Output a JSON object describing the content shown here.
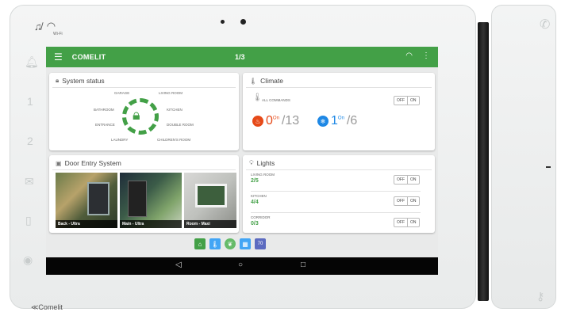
{
  "device": {
    "brand_logo": "≪Comelit",
    "wifi_label": "Wi-Fi",
    "colors": {
      "accent": "#43a047",
      "bezel": "#eeefef",
      "navbar": "#050505"
    }
  },
  "appbar": {
    "title": "COMELIT",
    "page": "1/3",
    "icons": [
      "menu-icon",
      "wifi-icon",
      "overflow-menu-icon"
    ]
  },
  "system_status": {
    "title": "System status",
    "zones": [
      "GARAGE",
      "LIVING ROOM",
      "BATHROOM",
      "KITCHEN",
      "ENTRANCE",
      "DOUBLE ROOM",
      "LAUNDRY",
      "CHILDREN'S ROOM"
    ]
  },
  "climate": {
    "title": "Climate",
    "all_commands_label": "ALL COMMANDS",
    "off_label": "OFF",
    "on_label": "ON",
    "heating": {
      "on": "0",
      "sup": "On",
      "total": "/13"
    },
    "cooling": {
      "on": "1",
      "sup": "On",
      "total": "/6"
    }
  },
  "door_entry": {
    "title": "Door Entry System",
    "cameras": [
      "Back - Ultra",
      "Main - Ultra",
      "Room - Maxi"
    ]
  },
  "lights": {
    "title": "Lights",
    "off_label": "OFF",
    "on_label": "ON",
    "rows": [
      {
        "name": "LIVING ROOM",
        "value": "2/5"
      },
      {
        "name": "KITCHEN",
        "value": "4/4"
      },
      {
        "name": "CORRIDOR",
        "value": "0/3"
      }
    ]
  },
  "app_icons": [
    {
      "name": "home-app-icon",
      "color": "#43a047"
    },
    {
      "name": "thermometer-app-icon",
      "color": "#42a5f5"
    },
    {
      "name": "leaf-app-icon",
      "color": "#66bb6a"
    },
    {
      "name": "grid-app-icon",
      "color": "#42a5f5"
    },
    {
      "name": "calendar-app-icon",
      "color": "#5c6bc0"
    }
  ],
  "calendar_icon_text": "70",
  "navbar": {
    "icons": [
      "back-icon",
      "home-icon",
      "recents-icon"
    ]
  }
}
